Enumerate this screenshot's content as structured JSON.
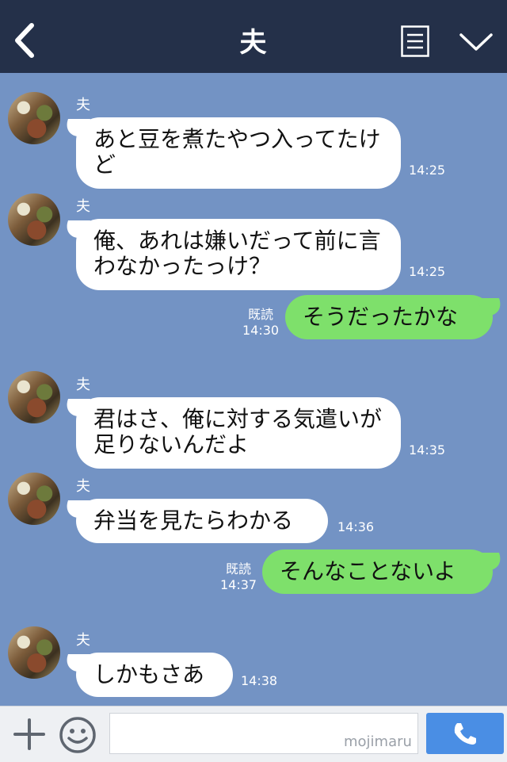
{
  "header": {
    "title": "夫",
    "back_icon": "chevron-left-icon",
    "menu_icon": "document-lines-icon",
    "expand_icon": "chevron-down-icon",
    "background": "#243049"
  },
  "chat": {
    "background": "#7393c4",
    "messages": [
      {
        "side": "left",
        "sender": "夫",
        "text": "あと豆を煮たやつ入ってたけど",
        "time": "14:25"
      },
      {
        "side": "left",
        "sender": "夫",
        "text": "俺、あれは嫌いだって前に言わなかったっけ？",
        "time": "14:25"
      },
      {
        "side": "right",
        "read": "既読",
        "text": "そうだったかな",
        "time": "14:30"
      },
      {
        "side": "left",
        "sender": "夫",
        "text": "君はさ、俺に対する気遣いが足りないんだよ",
        "time": "14:35"
      },
      {
        "side": "left",
        "sender": "夫",
        "text": "弁当を見たらわかる",
        "time": "14:36"
      },
      {
        "side": "right",
        "read": "既読",
        "text": "そんなことないよ",
        "time": "14:37"
      },
      {
        "side": "left",
        "sender": "夫",
        "text": "しかもさあ",
        "time": "14:38"
      }
    ]
  },
  "footer": {
    "plus_icon": "plus-icon",
    "sticker_icon": "smiley-icon",
    "input_value": "",
    "watermark": "mojimaru",
    "call_icon": "phone-icon",
    "call_color": "#4a8ee4"
  }
}
